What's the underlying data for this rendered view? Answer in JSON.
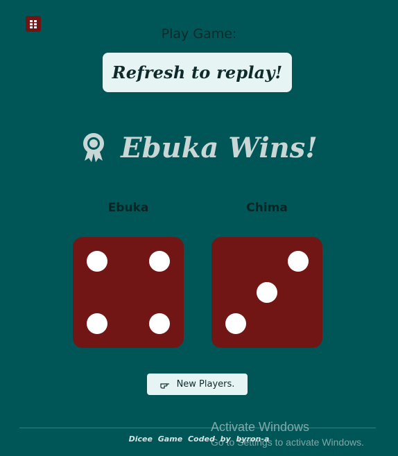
{
  "header": {
    "logo_icon": "dice-grid-icon",
    "play_label": "Play Game:",
    "refresh_label": "Refresh to replay!"
  },
  "result": {
    "icon": "award-ribbon-icon",
    "winner_text": "Ebuka Wins!"
  },
  "players": [
    {
      "name": "Ebuka",
      "die_value": 4
    },
    {
      "name": "Chima",
      "die_value": 3
    }
  ],
  "actions": {
    "new_players_icon": "pointing-hand-icon",
    "new_players_label": "New Players."
  },
  "footer": {
    "credit": "Dicee Game Coded by byron-a"
  },
  "watermark": {
    "title": "Activate Windows",
    "subtitle": "Go to Settings to activate Windows."
  },
  "colors": {
    "background": "#005657",
    "die": "#711614",
    "pip": "#ffffff",
    "button_bg": "#e6f4f4"
  }
}
